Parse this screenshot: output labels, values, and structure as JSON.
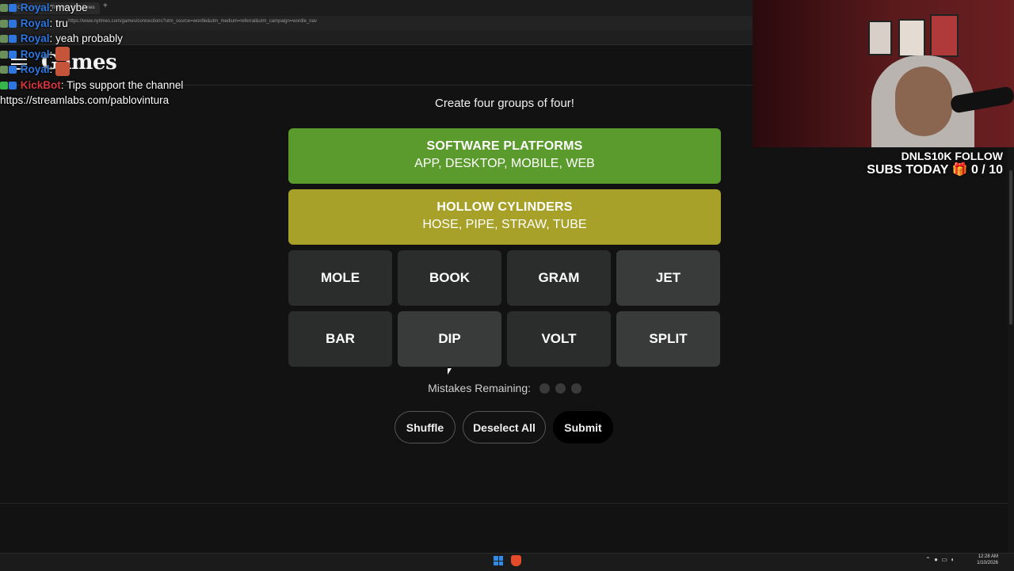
{
  "browser": {
    "tab_title": "Connections — The New York Times",
    "new_tab": "+",
    "url": "https://www.nytimes.com/games/connections?utm_source=wordle&utm_medium=referral&utm_campaign=wordle_nav"
  },
  "header": {
    "logo": "Games"
  },
  "chat": [
    {
      "user": "Royal",
      "sep": ":",
      "text": "maybe",
      "user_color": "#2d76e0"
    },
    {
      "user": "Royal",
      "sep": ":",
      "text": "tru",
      "user_color": "#2d76e0"
    },
    {
      "user": "Royal",
      "sep": ":",
      "text": "yeah probably",
      "user_color": "#2d76e0"
    },
    {
      "user": "Royal",
      "sep": ":",
      "text": "",
      "user_color": "#2d76e0"
    },
    {
      "user": "Royal",
      "sep": ":",
      "text": "",
      "user_color": "#2d76e0"
    },
    {
      "user": "KickBot",
      "sep": ":",
      "text": "Tips support the channel",
      "user_color": "#d8343c"
    },
    {
      "link": "https://streamlabs.com/pablovintura"
    }
  ],
  "game": {
    "subtitle": "Create four groups of four!",
    "solved": [
      {
        "category": "SOFTWARE PLATFORMS",
        "words": "APP, DESKTOP, MOBILE, WEB",
        "color": "#5b9a2c"
      },
      {
        "category": "HOLLOW CYLINDERS",
        "words": "HOSE, PIPE, STRAW, TUBE",
        "color": "#a7a12a"
      }
    ],
    "tiles": [
      "MOLE",
      "BOOK",
      "GRAM",
      "JET",
      "BAR",
      "DIP",
      "VOLT",
      "SPLIT"
    ],
    "mistakes_label": "Mistakes Remaining:",
    "mistakes_remaining": 3,
    "buttons": {
      "shuffle": "Shuffle",
      "deselect": "Deselect All",
      "submit": "Submit"
    }
  },
  "overlay": {
    "line1": "DNLS10K FOLLOW",
    "line2": "SUBS TODAY 🎁 0 / 10"
  },
  "taskbar": {
    "time": "12:28 AM",
    "date": "1/10/2026"
  }
}
